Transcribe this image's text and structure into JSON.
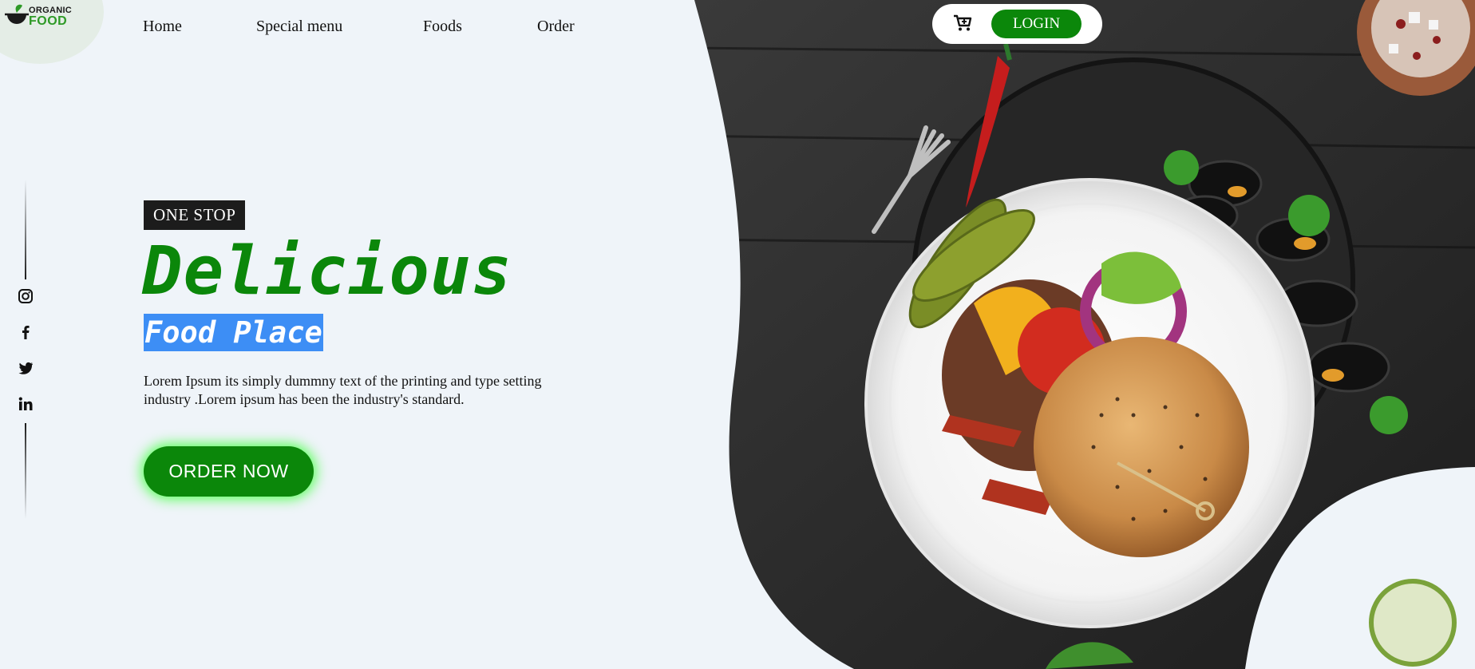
{
  "brand": {
    "logo_top": "ORGANIC",
    "logo_bottom": "FOOD"
  },
  "nav": {
    "items": [
      {
        "label": "Home"
      },
      {
        "label": "Special menu"
      },
      {
        "label": "Foods"
      },
      {
        "label": "Order"
      }
    ]
  },
  "topbar": {
    "cart_icon": "cart-plus-icon",
    "login_label": "LOGIN"
  },
  "social": [
    "instagram-icon",
    "facebook-icon",
    "twitter-icon",
    "linkedin-icon"
  ],
  "hero": {
    "badge": "ONE STOP",
    "headline": "Delicious",
    "subhead": "Food Place",
    "body": "Lorem Ipsum its simply dummny text of the printing and type setting industry .Lorem ipsum has been the industry's standard.",
    "cta_label": "ORDER NOW"
  },
  "colors": {
    "accent_green": "#0b870a",
    "highlight_blue": "#3d8ef5",
    "badge_dark": "#1c1c1c",
    "page_bg": "#eff4f9"
  }
}
